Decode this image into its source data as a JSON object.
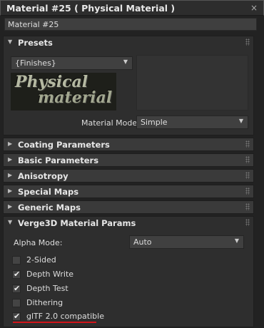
{
  "window": {
    "title": "Material #25  ( Physical Material )",
    "close": "×"
  },
  "material_name": "Material #25",
  "presets": {
    "header": "Presets",
    "dropdown": "{Finishes}",
    "preview_text_line1": "Physical",
    "preview_text_line2": "material",
    "mode_label": "Material Mode:",
    "mode_value": "Simple"
  },
  "rollouts": [
    "Coating Parameters",
    "Basic Parameters",
    "Anisotropy",
    "Special Maps",
    "Generic Maps"
  ],
  "verge": {
    "header": "Verge3D Material Params",
    "alpha_label": "Alpha Mode:",
    "alpha_value": "Auto",
    "checkboxes": [
      {
        "label": "2-Sided",
        "checked": false
      },
      {
        "label": "Depth Write",
        "checked": true
      },
      {
        "label": "Depth Test",
        "checked": true
      },
      {
        "label": "Dithering",
        "checked": false
      },
      {
        "label": "glTF 2.0 compatible",
        "checked": true
      }
    ]
  },
  "colors": {
    "highlight_underline": "#d1141a"
  },
  "icons": {
    "expanded": "triangle-down-icon",
    "collapsed": "triangle-right-icon",
    "check": "check-icon"
  }
}
